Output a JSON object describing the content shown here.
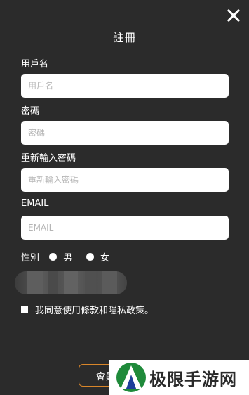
{
  "dialog": {
    "title": "註冊",
    "close_icon": "close-icon"
  },
  "fields": {
    "username": {
      "label": "用戶名",
      "placeholder": "用戶名",
      "value": ""
    },
    "password": {
      "label": "密碼",
      "placeholder": "密碼",
      "value": ""
    },
    "confirm_password": {
      "label": "重新輸入密碼",
      "placeholder": "重新輸入密碼",
      "value": ""
    },
    "email": {
      "label": "EMAIL",
      "placeholder": "EMAIL",
      "value": ""
    }
  },
  "gender": {
    "label": "性別",
    "options": [
      "男",
      "女"
    ]
  },
  "agreement": {
    "text": "我同意使用條款和隱私政策。"
  },
  "submit": {
    "label": "會員"
  },
  "watermark": {
    "text": "极限手游网"
  },
  "colors": {
    "background": "#2b2b2b",
    "button_border": "#d9862a",
    "input_bg": "#ffffff"
  }
}
